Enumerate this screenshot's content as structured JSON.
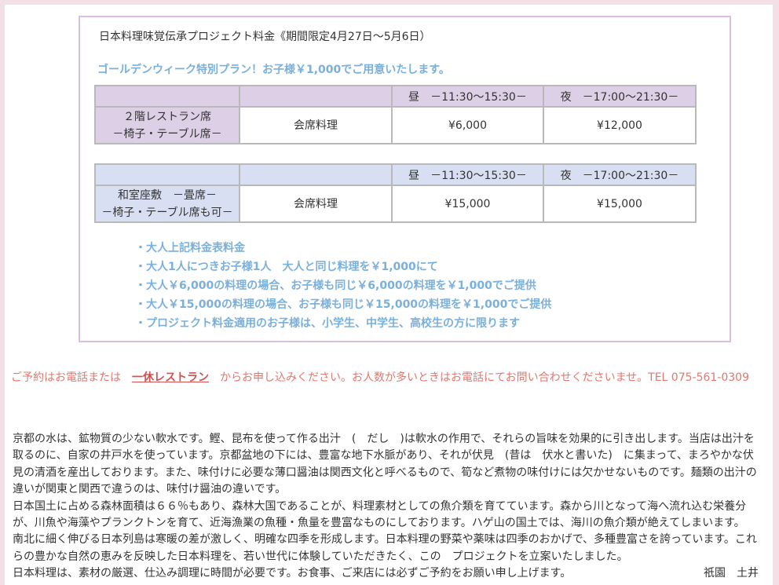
{
  "box": {
    "title": "日本料理味覚伝承プロジェクト料金《期間限定4月27日～5月6日）",
    "subtitle": "ゴールデンウィーク特別プラン！お子様￥1,000でご用意いたします。"
  },
  "table1": {
    "lunch_header": "昼　－11:30～15:30－",
    "dinner_header": "夜　－17:00～21:30－",
    "seat_line1": "２階レストラン席",
    "seat_line2": "－椅子・テーブル席－",
    "course": "会席料理",
    "lunch_price": "¥6,000",
    "dinner_price": "¥12,000"
  },
  "table2": {
    "lunch_header": "昼　－11:30～15:30－",
    "dinner_header": "夜　－17:00～21:30－",
    "seat_line1": "和室座敷　－畳席－",
    "seat_line2": "－椅子・テーブル席も可－",
    "course": "会席料理",
    "lunch_price": "¥15,000",
    "dinner_price": "¥15,000"
  },
  "notes": [
    "・大人上記料金表料金",
    "・大人1人につきお子様1人　大人と同じ料理を￥1,000にて",
    "・大人￥6,000の料理の場合、お子様も同じ￥6,000の料理を￥1,000でご提供",
    "・大人￥15,000の料理の場合、お子様も同じ￥15,000の料理を￥1,000でご提供",
    "・プロジェクト料金適用のお子様は、小学生、中学生、高校生の方に限ります"
  ],
  "reserve": {
    "before": "ご予約はお電話または　",
    "link": "一休レストラン",
    "after": "　からお申し込みください。お人数が多いときはお電話にてお問い合わせくださいませ。TEL 075-561-0309"
  },
  "body_lines": [
    "京都の水は、鉱物質の少ない軟水です。鰹、昆布を使って作る出汁　(　だし　)は軟水の作用で、それらの旨味を効果的に引き出します。当店は出汁を",
    "取るのに、自家の井戸水を使っています。京都盆地の下には、豊富な地下水脈があり、それが伏見　(昔は　伏水と書いた)　に集まって、まろやかな伏",
    "見の清酒を産出しております。また、味付けに必要な薄口醤油は関西文化と呼べるもので、筍など煮物の味付けには欠かせないものです。麺類の出汁の",
    "違いが関東と関西で違うのは、味付け醤油の違いです。",
    "日本国土に占める森林面積は６６％もあり、森林大国であることが、料理素材としての魚介類を育てています。森から川となって海へ流れ込む栄養分",
    "が、川魚や海藻やプランクトンを育て、近海漁業の魚種・魚量を豊富なものにしております。ハゲ山の国土では、海川の魚介類が絶えてしまいます。",
    "南北に細く伸びる日本列島は寒暖の差が激しく、明確な四季を形成します。日本料理の野菜や薬味は四季のおかげで、多種豊富さを誇っています。これ",
    "らの豊かな自然の恵みを反映した日本料理を、若い世代に体験していただきたく、この　プロジェクトを立案いたしました。"
  ],
  "last_line": "日本料理は、素材の厳選、仕込み調理に時間が必要です。お食事、ご来店には必ずご予約をお願い申し上げます。",
  "signature": "祇園　土井"
}
